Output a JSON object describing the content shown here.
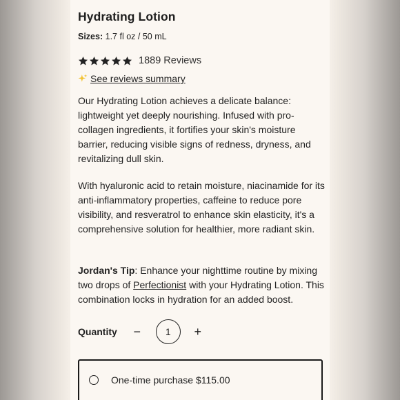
{
  "product": {
    "title": "Hydrating Lotion",
    "sizes_label": "Sizes:",
    "sizes_value": "1.7 fl oz / 50 mL"
  },
  "rating": {
    "stars": 5,
    "star_color": "#222222",
    "reviews_text": "1889 Reviews"
  },
  "summary": {
    "icon": "sparkle-icon",
    "icon_color": "#f2c230",
    "link_text": "See reviews summary"
  },
  "description": {
    "p1": "Our Hydrating Lotion achieves a delicate balance: lightweight yet deeply nourishing. Infused with pro-collagen ingredients, it fortifies your skin's moisture barrier, reducing visible signs of redness, dryness, and revitalizing dull skin.",
    "p2": "With hyaluronic acid to retain moisture, niacinamide for its anti-inflammatory properties, caffeine to reduce pore visibility, and resveratrol to enhance skin elasticity, it's a comprehensive solution for healthier, more radiant skin.",
    "tip_label": "Jordan's Tip",
    "tip_prefix": ": Enhance your nighttime routine by mixing two drops of ",
    "tip_link": "Perfectionist",
    "tip_suffix": " with your Hydrating Lotion. This combination locks in hydration for an added boost."
  },
  "quantity": {
    "label": "Quantity",
    "decrement": "−",
    "value": "1",
    "increment": "+"
  },
  "purchase": {
    "one_time_label": "One-time purchase $115.00"
  }
}
